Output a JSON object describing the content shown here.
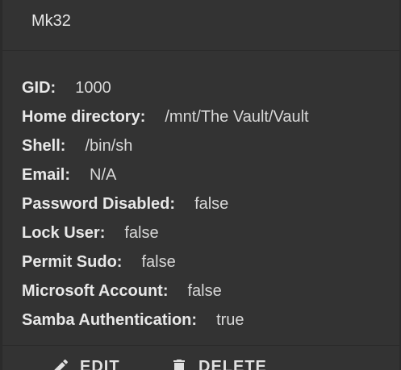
{
  "header": {
    "title": "Mk32"
  },
  "details": [
    {
      "label": "GID:",
      "value": "1000"
    },
    {
      "label": "Home directory:",
      "value": "/mnt/The Vault/Vault"
    },
    {
      "label": "Shell:",
      "value": "/bin/sh"
    },
    {
      "label": "Email:",
      "value": "N/A"
    },
    {
      "label": "Password Disabled:",
      "value": "false"
    },
    {
      "label": "Lock User:",
      "value": "false"
    },
    {
      "label": "Permit Sudo:",
      "value": "false"
    },
    {
      "label": "Microsoft Account:",
      "value": "false"
    },
    {
      "label": "Samba Authentication:",
      "value": "true"
    }
  ],
  "footer": {
    "edit_label": "EDIT",
    "edit_icon": "pencil-icon",
    "delete_label": "DELETE",
    "delete_icon": "trash-icon"
  },
  "colors": {
    "background": "#333333",
    "text": "#e6e6e6"
  }
}
